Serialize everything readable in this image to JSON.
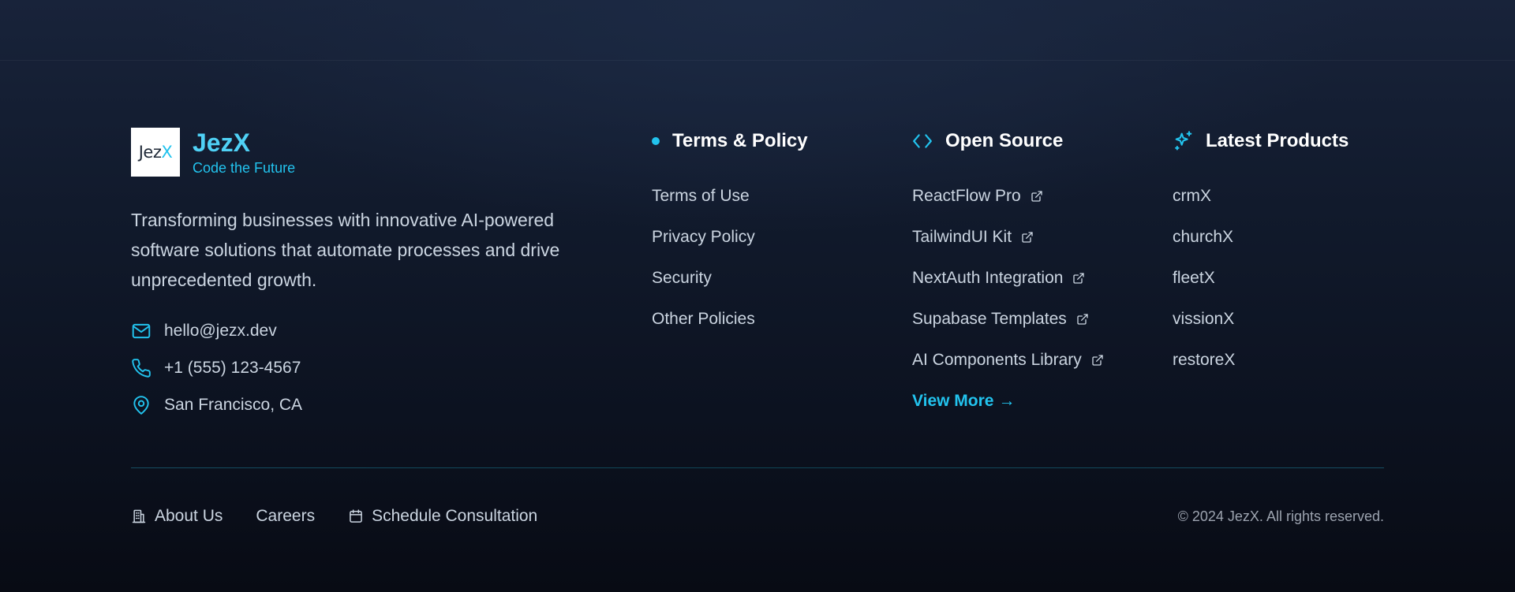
{
  "brand": {
    "logo_text": "Jez",
    "logo_accent": "X",
    "name": "JezX",
    "tagline": "Code the Future",
    "description": "Transforming businesses with innovative AI-powered software solutions that automate processes and drive unprecedented growth."
  },
  "contact": {
    "email": "hello@jezx.dev",
    "phone": "+1 (555) 123-4567",
    "location": "San Francisco, CA"
  },
  "columns": {
    "terms": {
      "heading": "Terms & Policy",
      "links": [
        "Terms of Use",
        "Privacy Policy",
        "Security",
        "Other Policies"
      ]
    },
    "open_source": {
      "heading": "Open Source",
      "links": [
        "ReactFlow Pro",
        "TailwindUI Kit",
        "NextAuth Integration",
        "Supabase Templates",
        "AI Components Library"
      ],
      "view_more": "View More",
      "view_more_arrow": "→"
    },
    "products": {
      "heading": "Latest Products",
      "links": [
        "crmX",
        "churchX",
        "fleetX",
        "vissionX",
        "restoreX"
      ]
    }
  },
  "bottom": {
    "links": [
      "About Us",
      "Careers",
      "Schedule Consultation"
    ],
    "copyright": "© 2024 JezX. All rights reserved."
  },
  "icons": {
    "terms": "dot-icon",
    "open_source": "code-brackets-icon",
    "products": "sparkle-icon",
    "external": "external-link-icon",
    "email": "mail-icon",
    "phone": "phone-icon",
    "location": "map-pin-icon",
    "about": "building-icon",
    "schedule": "calendar-icon"
  },
  "colors": {
    "accent": "#22c3ee",
    "heading": "#ffffff",
    "text": "#cbd5e1",
    "muted": "#9ca3af"
  }
}
